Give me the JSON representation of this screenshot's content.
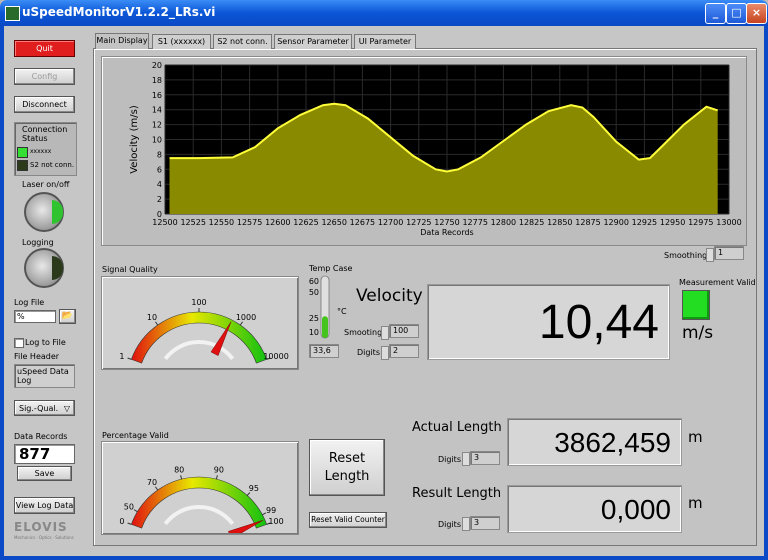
{
  "window": {
    "title": "uSpeedMonitorV1.2.2_LRs.vi"
  },
  "left": {
    "quit_label": "Quit",
    "config_label": "Config",
    "disconnect_label": "Disconnect",
    "connection_status_label": "Connection Status",
    "sensor1_label": "xxxxxx",
    "sensor2_label": "S2 not conn.",
    "laser_label": "Laser on/off",
    "logging_label": "Logging",
    "logfile_label": "Log File",
    "logfile_value": "%",
    "log_to_file_label": "Log to File",
    "file_header_label": "File Header",
    "file_header_value": "uSpeed Data Log",
    "sigqual_value": "Sig.-Qual.",
    "data_records_label": "Data Records",
    "data_records_value": "877",
    "save_label": "Save",
    "view_log_label": "View Log Data",
    "logo_text": "ELOVIS",
    "logo_tagline": "Mechanics · Optics · Solutions"
  },
  "tabs": [
    {
      "label": "Main Display"
    },
    {
      "label": "S1 (xxxxxx)"
    },
    {
      "label": "S2 not conn."
    },
    {
      "label": "Sensor Parameter"
    },
    {
      "label": "UI Parameter"
    }
  ],
  "chart_data": {
    "type": "area",
    "xlabel": "Data Records",
    "ylabel": "Velocity (m/s)",
    "xlim": [
      12500,
      13000
    ],
    "ylim": [
      0,
      20
    ],
    "x_ticks": [
      12500,
      12525,
      12550,
      12575,
      12600,
      12625,
      12650,
      12675,
      12700,
      12725,
      12750,
      12775,
      12800,
      12825,
      12850,
      12875,
      12900,
      12925,
      12950,
      12975,
      13000
    ],
    "y_ticks": [
      0,
      2,
      4,
      6,
      8,
      10,
      12,
      14,
      16,
      18,
      20
    ],
    "series": [
      {
        "x": [
          12504,
          12530,
          12560,
          12580,
          12600,
          12620,
          12640,
          12650,
          12660,
          12680,
          12700,
          12720,
          12740,
          12750,
          12760,
          12780,
          12800,
          12820,
          12840,
          12860,
          12870,
          12880,
          12900,
          12920,
          12930,
          12940,
          12960,
          12980,
          12990
        ],
        "y": [
          7.5,
          7.5,
          7.6,
          9.0,
          11.5,
          13.3,
          14.6,
          14.8,
          14.6,
          12.8,
          10.3,
          7.8,
          6.0,
          5.7,
          6.0,
          7.6,
          9.8,
          12.0,
          13.8,
          14.6,
          14.3,
          13.0,
          9.7,
          7.3,
          7.5,
          9.0,
          12.0,
          14.4,
          13.9
        ]
      }
    ],
    "fill_color": "#8a8a00",
    "line_color": "#ffff3a",
    "background": "#000000",
    "grid": true
  },
  "smoothing": {
    "label": "Smoothing",
    "value": "1"
  },
  "signal_quality": {
    "label": "Signal Quality",
    "scale_labels": [
      "1",
      "10",
      "100",
      "1000",
      "10000"
    ],
    "value": 600
  },
  "temp_case": {
    "label": "Temp Case",
    "ticks": [
      "60",
      "50",
      "25",
      "10"
    ],
    "unit": "°C",
    "value": "33,6",
    "fill_fraction": 0.35
  },
  "velocity": {
    "label": "Velocity",
    "value": "10,44",
    "unit": "m/s",
    "smoothing_label": "Smooting",
    "smoothing_value": "100",
    "digits_label": "Digits",
    "digits_value": "2"
  },
  "measurement_valid": {
    "label": "Measurement Valid",
    "color": "#22dd22"
  },
  "percentage_valid": {
    "label": "Percentage Valid",
    "scale_labels": [
      "0",
      "50",
      "70",
      "80",
      "90",
      "95",
      "99",
      "100"
    ],
    "value": 99.5
  },
  "reset_length_label": "Reset Length",
  "reset_valid_label": "Reset Valid Counter",
  "actual_length": {
    "label": "Actual Length",
    "value": "3862,459",
    "unit": "m",
    "digits_label": "Digits",
    "digits_value": "3"
  },
  "result_length": {
    "label": "Result Length",
    "value": "0,000",
    "unit": "m",
    "digits_label": "Digits",
    "digits_value": "3"
  }
}
